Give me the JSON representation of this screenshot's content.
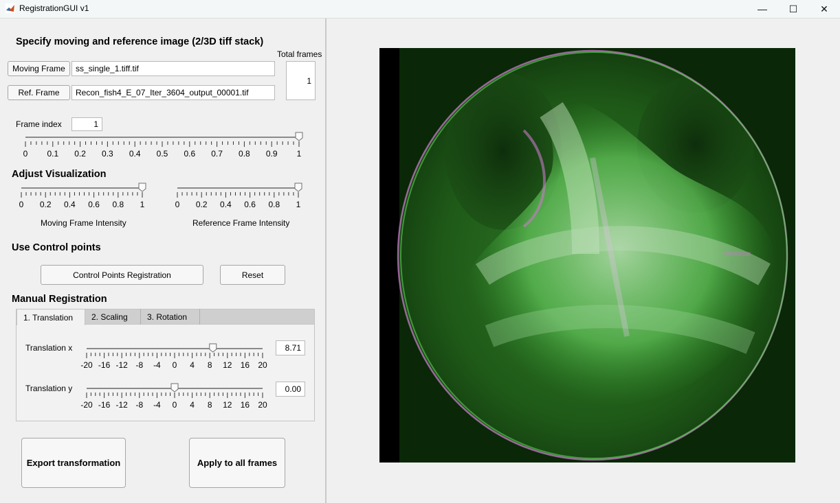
{
  "window": {
    "title": "RegistrationGUI v1",
    "controls": {
      "minimize": "—",
      "maximize": "☐",
      "close": "✕"
    }
  },
  "spec": {
    "heading": "Specify moving and reference image (2/3D tiff stack)",
    "moving_button": "Moving Frame",
    "moving_file": "ss_single_1.tiff.tif",
    "ref_button": "Ref. Frame",
    "ref_file": "Recon_fish4_E_07_Iter_3604_output_00001.tif",
    "total_frames_label": "Total frames",
    "total_frames_value": "1"
  },
  "frame": {
    "label": "Frame index",
    "value": "1",
    "slider_value": 1.0,
    "ticks": [
      "0",
      "0.1",
      "0.2",
      "0.3",
      "0.4",
      "0.5",
      "0.6",
      "0.7",
      "0.8",
      "0.9",
      "1"
    ]
  },
  "visualization": {
    "heading": "Adjust Visualization",
    "moving": {
      "label": "Moving Frame Intensity",
      "value": 1.0,
      "ticks": [
        "0",
        "0.2",
        "0.4",
        "0.6",
        "0.8",
        "1"
      ]
    },
    "reference": {
      "label": "Reference Frame Intensity",
      "value": 1.0,
      "ticks": [
        "0",
        "0.2",
        "0.4",
        "0.6",
        "0.8",
        "1"
      ]
    }
  },
  "control_points": {
    "heading": "Use Control points",
    "register_button": "Control Points Registration",
    "reset_button": "Reset"
  },
  "manual": {
    "heading": "Manual Registration",
    "tabs": [
      "1. Translation",
      "2. Scaling",
      "3. Rotation"
    ],
    "active_tab": 0,
    "translation_x": {
      "label": "Translation x",
      "value": "8.71",
      "slider_value": 8.71,
      "ticks": [
        "-20",
        "-16",
        "-12",
        "-8",
        "-4",
        "0",
        "4",
        "8",
        "12",
        "16",
        "20"
      ]
    },
    "translation_y": {
      "label": "Translation y",
      "value": "0.00",
      "slider_value": 0.0,
      "ticks": [
        "-20",
        "-16",
        "-12",
        "-8",
        "-4",
        "0",
        "4",
        "8",
        "12",
        "16",
        "20"
      ]
    }
  },
  "actions": {
    "export_button": "Export transformation",
    "apply_button": "Apply to all frames"
  },
  "colors": {
    "background": "#f0f0f0",
    "image_green": "#3fbf3a",
    "image_magenta": "#c77ac9"
  }
}
